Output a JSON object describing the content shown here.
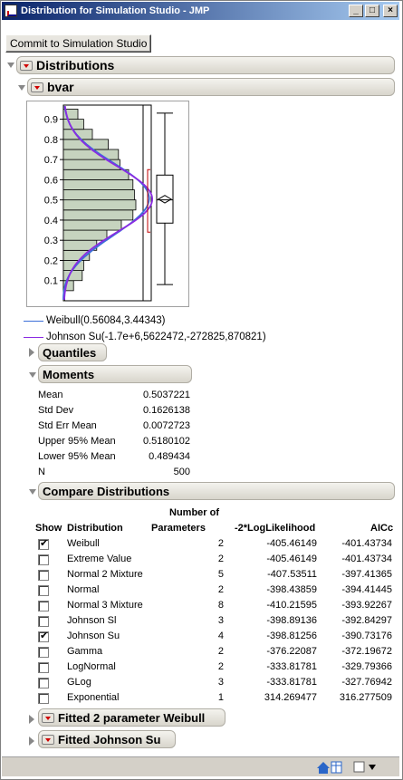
{
  "window": {
    "title": "Distribution for Simulation Studio - JMP",
    "min_glyph": "_",
    "max_glyph": "□",
    "close_glyph": "×"
  },
  "toolbar": {
    "commit_label": "Commit to Simulation Studio"
  },
  "outline": {
    "distributions": "Distributions",
    "variable": "bvar",
    "quantiles": "Quantiles",
    "moments": "Moments",
    "compare": "Compare Distributions",
    "fitted_weibull": "Fitted 2 parameter Weibull",
    "fitted_johnson": "Fitted Johnson Su"
  },
  "chart_data": {
    "type": "bar",
    "orientation": "horizontal",
    "bin_edges": [
      0.0,
      0.05,
      0.1,
      0.15,
      0.2,
      0.25,
      0.3,
      0.35,
      0.4,
      0.45,
      0.5,
      0.55,
      0.6,
      0.65,
      0.7,
      0.75,
      0.8,
      0.85,
      0.9,
      0.95
    ],
    "counts": [
      1,
      7,
      13,
      14,
      18,
      23,
      30,
      40,
      48,
      50,
      49,
      48,
      45,
      39,
      38,
      31,
      20,
      14,
      10
    ],
    "y_ticks": [
      "0.1",
      "0.2",
      "0.3",
      "0.4",
      "0.5",
      "0.6",
      "0.7",
      "0.8",
      "0.9"
    ],
    "ylim": [
      0.0,
      0.97
    ],
    "boxplot": {
      "min": 0.08,
      "q1": 0.385,
      "median": 0.5,
      "q3": 0.623,
      "max": 0.93,
      "mean": 0.5037221,
      "lower95": 0.489434,
      "upper95": 0.5180102,
      "shortest_half_low": 0.34,
      "shortest_half_high": 0.65
    },
    "fits": [
      {
        "name": "Weibull",
        "color": "#3b6fd8",
        "shape": 3.44343,
        "scale": 0.56084
      },
      {
        "name": "Johnson Su",
        "color": "#8a2be2"
      }
    ]
  },
  "legend": [
    {
      "text": "Weibull(0.56084,3.44343)",
      "color": "#3b6fd8"
    },
    {
      "text": "Johnson Su(-1.7e+6,5622472,-272825,870821)",
      "color": "#8a2be2"
    }
  ],
  "moments": [
    {
      "label": "Mean",
      "value": "0.5037221"
    },
    {
      "label": "Std Dev",
      "value": "0.1626138"
    },
    {
      "label": "Std Err Mean",
      "value": "0.0072723"
    },
    {
      "label": "Upper 95% Mean",
      "value": "0.5180102"
    },
    {
      "label": "Lower 95% Mean",
      "value": "0.489434"
    },
    {
      "label": "N",
      "value": "500"
    }
  ],
  "compare": {
    "headers": {
      "show": "Show",
      "distribution": "Distribution",
      "nparams_top": "Number of",
      "nparams": "Parameters",
      "loglik": "-2*LogLikelihood",
      "aicc": "AICc"
    },
    "rows": [
      {
        "show": true,
        "name": "Weibull",
        "n": "2",
        "ll": "-405.46149",
        "aicc": "-401.43734"
      },
      {
        "show": false,
        "name": "Extreme Value",
        "n": "2",
        "ll": "-405.46149",
        "aicc": "-401.43734"
      },
      {
        "show": false,
        "name": "Normal 2 Mixture",
        "n": "5",
        "ll": "-407.53511",
        "aicc": "-397.41365"
      },
      {
        "show": false,
        "name": "Normal",
        "n": "2",
        "ll": "-398.43859",
        "aicc": "-394.41445"
      },
      {
        "show": false,
        "name": "Normal 3 Mixture",
        "n": "8",
        "ll": "-410.21595",
        "aicc": "-393.92267"
      },
      {
        "show": false,
        "name": "Johnson Sl",
        "n": "3",
        "ll": "-398.89136",
        "aicc": "-392.84297"
      },
      {
        "show": true,
        "name": "Johnson Su",
        "n": "4",
        "ll": "-398.81256",
        "aicc": "-390.73176"
      },
      {
        "show": false,
        "name": "Gamma",
        "n": "2",
        "ll": "-376.22087",
        "aicc": "-372.19672"
      },
      {
        "show": false,
        "name": "LogNormal",
        "n": "2",
        "ll": "-333.81781",
        "aicc": "-329.79366"
      },
      {
        "show": false,
        "name": "GLog",
        "n": "3",
        "ll": "-333.81781",
        "aicc": "-327.76942"
      },
      {
        "show": false,
        "name": "Exponential",
        "n": "1",
        "ll": "314.269477",
        "aicc": "316.277509"
      }
    ]
  }
}
